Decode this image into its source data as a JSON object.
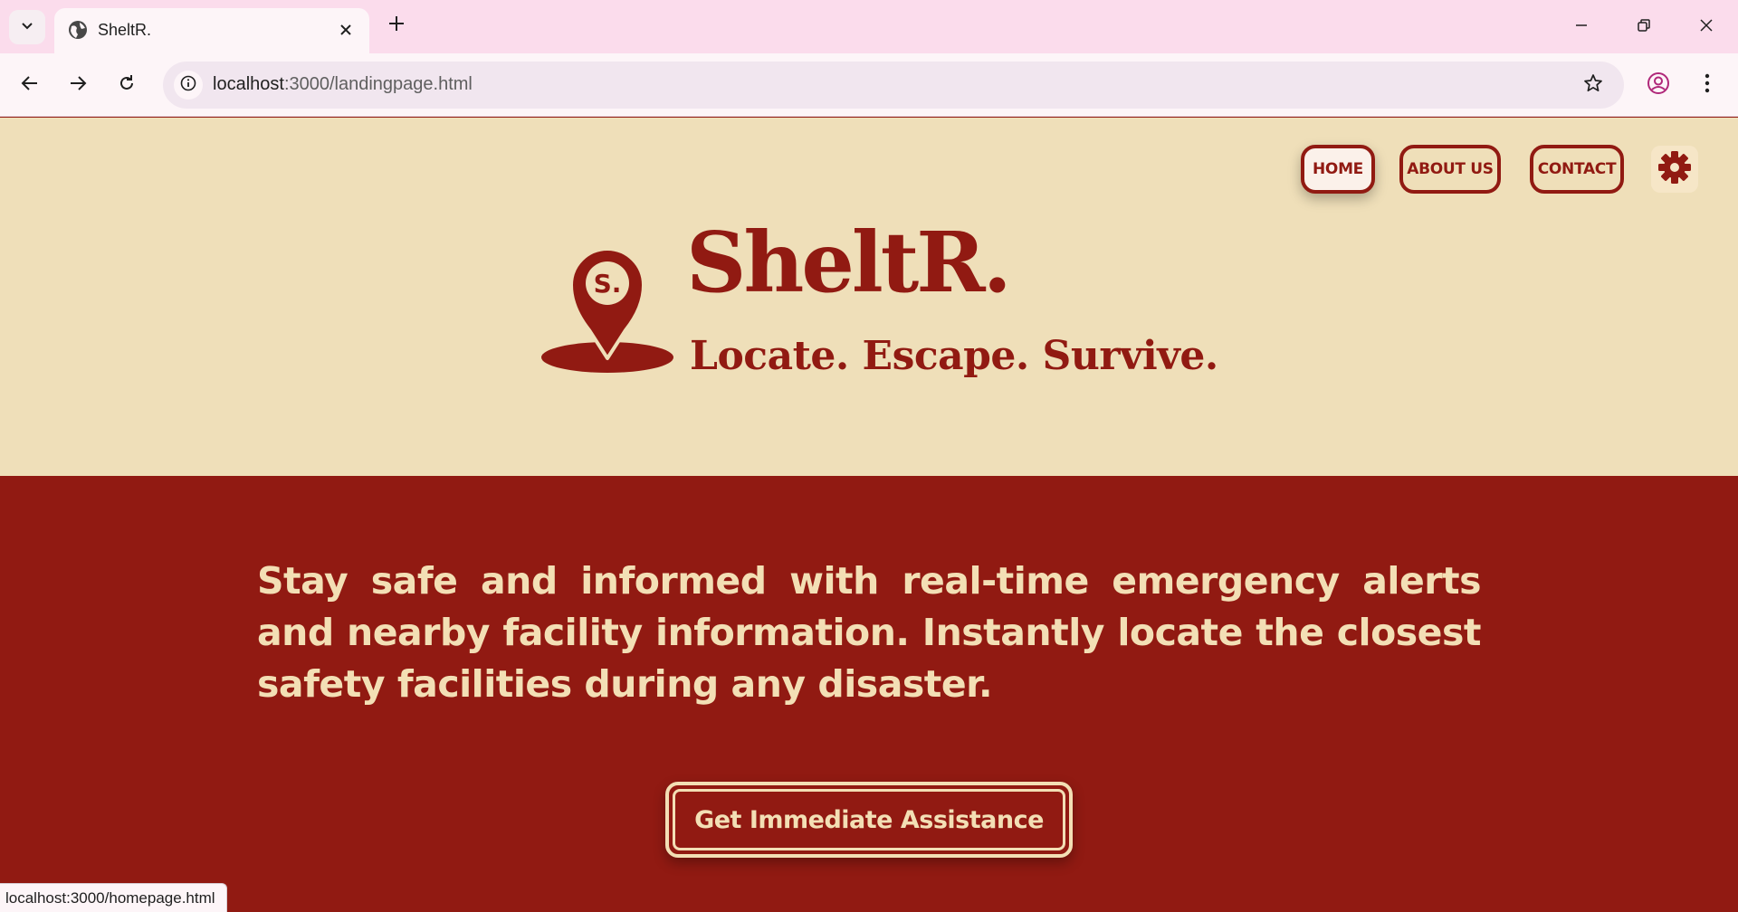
{
  "browser": {
    "tab_title": "SheltR.",
    "url_host": "localhost",
    "url_rest": ":3000/landingpage.html",
    "status_url": "localhost:3000/homepage.html",
    "icons": [
      "tab-search-icon",
      "globe-icon",
      "close-icon",
      "plus-icon",
      "minimize-icon",
      "restore-icon",
      "window-close-icon",
      "back-icon",
      "forward-icon",
      "reload-icon",
      "info-icon",
      "star-icon",
      "profile-icon",
      "kebab-menu-icon"
    ]
  },
  "nav": {
    "items": [
      {
        "label": "HOME",
        "active": true
      },
      {
        "label": "ABOUT US",
        "active": false
      },
      {
        "label": "CONTACT",
        "active": false
      }
    ],
    "settings_icon": "gear-icon"
  },
  "hero": {
    "logo_mark_text": "S.",
    "brand": "SheltR.",
    "tagline": "Locate. Escape. Survive."
  },
  "main": {
    "lead": "Stay safe and informed with real-time emergency alerts and nearby facility information. Instantly locate the closest safety facilities during any disaster.",
    "cta_label": "Get Immediate Assistance"
  },
  "colors": {
    "primary": "#911a12",
    "cream": "#efdfb9",
    "text_light": "#f3dfb5",
    "tabbar": "#fbdcec"
  }
}
